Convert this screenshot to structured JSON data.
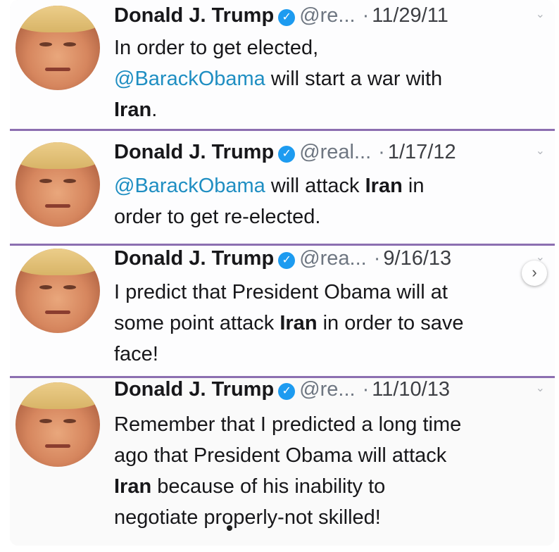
{
  "tweets": [
    {
      "name": "Donald J. Trump",
      "handle": "@re...",
      "date": "11/29/11",
      "body": [
        {
          "text": "In order to get elected,",
          "style": "plain",
          "br": true
        },
        {
          "text": "@BarackObama",
          "style": "mention"
        },
        {
          "text": " will start a war with",
          "style": "plain",
          "br": true
        },
        {
          "text": "Iran",
          "style": "bold"
        },
        {
          "text": ".",
          "style": "plain"
        }
      ]
    },
    {
      "name": "Donald J. Trump",
      "handle": "@real...",
      "date": "1/17/12",
      "body": [
        {
          "text": "@BarackObama",
          "style": "mention"
        },
        {
          "text": " will attack ",
          "style": "plain"
        },
        {
          "text": "Iran",
          "style": "bold"
        },
        {
          "text": " in",
          "style": "plain",
          "br": true
        },
        {
          "text": "order to get re-elected.",
          "style": "plain"
        }
      ]
    },
    {
      "name": "Donald J. Trump",
      "handle": "@rea...",
      "date": "9/16/13",
      "body": [
        {
          "text": "I predict that President Obama will at",
          "style": "plain",
          "br": true
        },
        {
          "text": "some point attack ",
          "style": "plain"
        },
        {
          "text": "Iran",
          "style": "bold"
        },
        {
          "text": " in order to save",
          "style": "plain",
          "br": true
        },
        {
          "text": "face!",
          "style": "plain"
        }
      ]
    },
    {
      "name": "Donald J. Trump",
      "handle": "@re...",
      "date": "11/10/13",
      "body": [
        {
          "text": "Remember that I predicted a long time",
          "style": "plain",
          "br": true
        },
        {
          "text": "ago that President Obama will attack",
          "style": "plain",
          "br": true
        },
        {
          "text": "Iran",
          "style": "bold"
        },
        {
          "text": " because of his inability to",
          "style": "plain",
          "br": true
        },
        {
          "text": "negotiate properly-not skilled!",
          "style": "plain"
        }
      ]
    }
  ],
  "icons": {
    "verified": "verified-checkmark-icon",
    "more": "chevron-down-icon",
    "next": "chevron-right-icon"
  },
  "colors": {
    "mention": "#1f8ec2",
    "verified": "#1d9bf0",
    "divider": "#8c6fb1"
  }
}
